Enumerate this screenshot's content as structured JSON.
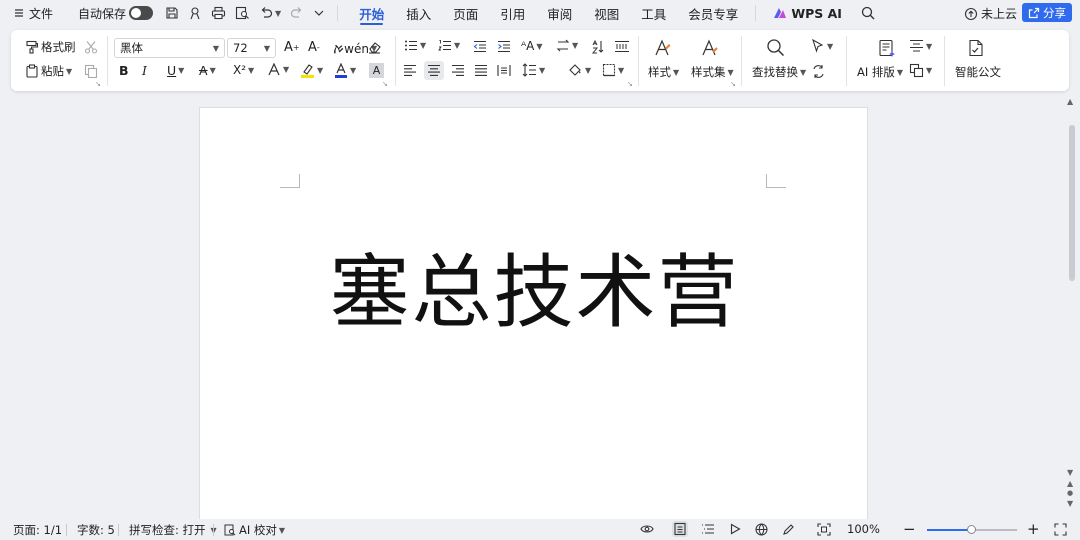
{
  "topbar": {
    "file_label": "文件",
    "autosave_label": "自动保存",
    "tabs": [
      "开始",
      "插入",
      "页面",
      "引用",
      "审阅",
      "视图",
      "工具",
      "会员专享"
    ],
    "active_tab": "开始",
    "wps_ai_label": "WPS AI",
    "cloud_label": "未上云",
    "share_label": "分享"
  },
  "ribbon": {
    "format_painter": "格式刷",
    "paste": "粘贴",
    "font_name": "黑体",
    "font_size": "72",
    "styles": "样式",
    "style_set": "样式集",
    "find_replace": "查找替换",
    "ai_layout": "AI 排版",
    "smart_doc": "智能公文",
    "bold": "B",
    "italic": "I",
    "underline": "U",
    "strike": "A",
    "superscript": "X²",
    "shade_char": "A",
    "accent_color": "#2b5fd9"
  },
  "document": {
    "title_text": "塞总技术营"
  },
  "statusbar": {
    "page": "页面: 1/1",
    "word_count": "字数: 5",
    "spell_check": "拼写检查: 打开",
    "ai_proofread": "AI 校对",
    "zoom": "100%",
    "zoom_level": 0.5
  }
}
